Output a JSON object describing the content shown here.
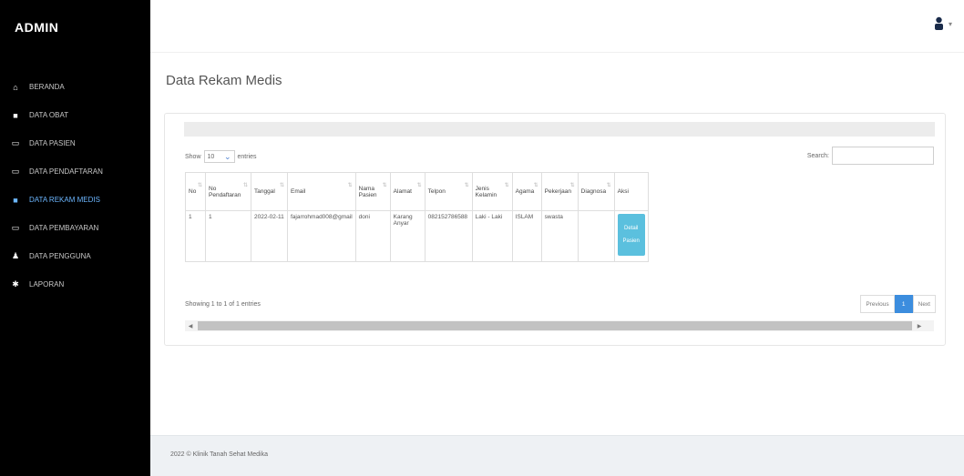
{
  "sidebar": {
    "brand": "ADMIN",
    "items": [
      {
        "label": "BERANDA",
        "icon": "home-icon",
        "glyph": "⌂"
      },
      {
        "label": "DATA OBAT",
        "icon": "pill-icon",
        "glyph": "■"
      },
      {
        "label": "DATA PASIEN",
        "icon": "calendar-icon",
        "glyph": "▭"
      },
      {
        "label": "DATA PENDAFTARAN",
        "icon": "calendar-icon",
        "glyph": "▭"
      },
      {
        "label": "DATA REKAM MEDIS",
        "icon": "medical-record-icon",
        "glyph": "■"
      },
      {
        "label": "DATA PEMBAYARAN",
        "icon": "calendar-icon",
        "glyph": "▭"
      },
      {
        "label": "DATA PENGGUNA",
        "icon": "user-icon",
        "glyph": "♟"
      },
      {
        "label": "LAPORAN",
        "icon": "gear-icon",
        "glyph": "✱"
      }
    ],
    "active_index": 4
  },
  "header": {
    "user_icon": "user-icon"
  },
  "page": {
    "title": "Data Rekam Medis"
  },
  "table_controls": {
    "show_label": "Show",
    "entries_value": "10",
    "entries_label": "entries",
    "search_label": "Search:"
  },
  "table": {
    "columns": [
      "No",
      "No Pendaftaran",
      "Tanggal",
      "Email",
      "Nama Pasien",
      "Alamat",
      "Telpon",
      "Jenis Kelamin",
      "Agama",
      "Pekerjaan",
      "Diagnosa",
      "Aksi"
    ],
    "rows": [
      [
        "1",
        "1",
        "2022-02-11",
        "fajarrohmad008@gmail",
        "doni",
        "Karang Anyar",
        "082152786588",
        "Laki - Laki",
        "ISLAM",
        "swasta",
        ""
      ]
    ],
    "action_label": [
      "Detail",
      "Pasien"
    ]
  },
  "info": "Showing 1 to 1 of 1 entries",
  "pagination": {
    "previous": "Previous",
    "current": "1",
    "next": "Next"
  },
  "footer": "2022 © Klinik Tanah Sehat Medika",
  "colors": {
    "sidebar_bg": "#000000",
    "active": "#6cb6ff",
    "button": "#5bc0de",
    "page_active": "#3c8dde"
  }
}
